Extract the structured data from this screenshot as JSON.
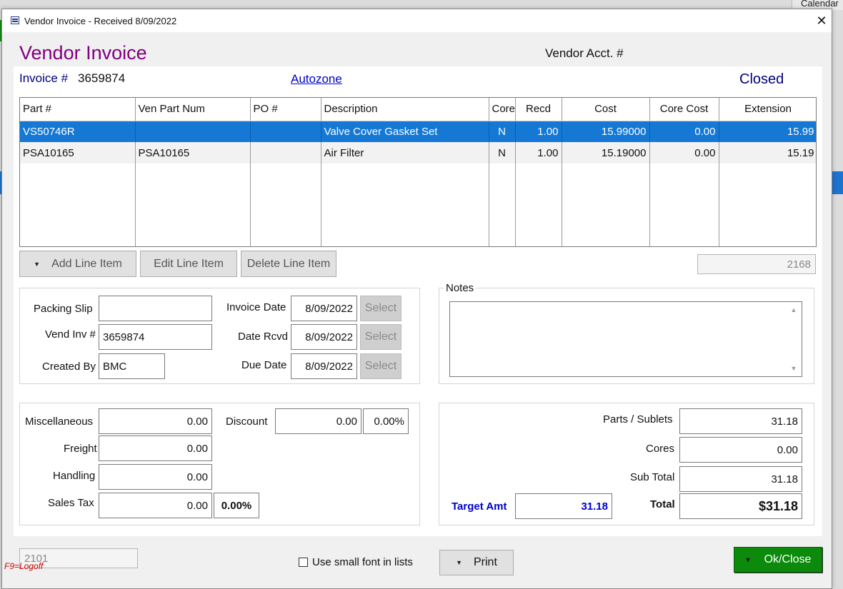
{
  "background": {
    "top_right_text": "Calendar"
  },
  "window": {
    "title": "Vendor Invoice - Received  8/09/2022",
    "close_glyph": "✕"
  },
  "header": {
    "title": "Vendor Invoice",
    "vendor_acct_label": "Vendor Acct. #",
    "invoice_label": "Invoice #",
    "invoice_number": "3659874",
    "vendor_name": "Autozone",
    "status": "Closed"
  },
  "grid": {
    "columns": [
      "Part #",
      "Ven Part Num",
      "PO #",
      "Description",
      "Core",
      "Recd",
      "Cost",
      "Core Cost",
      "Extension"
    ],
    "rows": [
      {
        "part": "VS50746R",
        "ven_part": "",
        "po": "",
        "description": "Valve Cover Gasket Set",
        "core": "N",
        "recd": "1.00",
        "cost": "15.99000",
        "core_cost": "0.00",
        "extension": "15.99",
        "selected": true
      },
      {
        "part": "PSA10165",
        "ven_part": "PSA10165",
        "po": "",
        "description": "Air Filter",
        "core": "N",
        "recd": "1.00",
        "cost": "15.19000",
        "core_cost": "0.00",
        "extension": "15.19",
        "selected": false
      }
    ]
  },
  "line_buttons": {
    "add": "Add Line Item",
    "edit": "Edit Line Item",
    "delete": "Delete Line Item"
  },
  "grid_id_box": "2168",
  "details": {
    "packing_slip_label": "Packing Slip",
    "packing_slip": "",
    "vend_inv_label": "Vend Inv #",
    "vend_inv": "3659874",
    "created_by_label": "Created By",
    "created_by": "BMC",
    "invoice_date_label": "Invoice Date",
    "invoice_date": "8/09/2022",
    "date_rcvd_label": "Date Rcvd",
    "date_rcvd": "8/09/2022",
    "due_date_label": "Due Date",
    "due_date": "8/09/2022",
    "select_label": "Select"
  },
  "notes": {
    "label": "Notes",
    "value": ""
  },
  "charges": {
    "misc_label": "Miscellaneous",
    "misc": "0.00",
    "freight_label": "Freight",
    "freight": "0.00",
    "handling_label": "Handling",
    "handling": "0.00",
    "sales_tax_label": "Sales Tax",
    "sales_tax": "0.00",
    "sales_tax_pct": "0.00%",
    "discount_label": "Discount",
    "discount": "0.00",
    "discount_pct": "0.00%"
  },
  "totals": {
    "parts_label": "Parts / Sublets",
    "parts": "31.18",
    "cores_label": "Cores",
    "cores": "0.00",
    "subtotal_label": "Sub Total",
    "subtotal": "31.18",
    "target_label": "Target Amt",
    "target": "31.18",
    "total_label": "Total",
    "total": "$31.18"
  },
  "footer": {
    "id_box": "2101",
    "small_font_label": "Use small font in lists",
    "print_label": "Print",
    "ok_label": "Ok/Close",
    "logoff_hint": "F9=Logoff"
  },
  "colors": {
    "title_purple": "#800080",
    "navy": "#000080",
    "selection_blue": "#1478d4",
    "ok_green": "#0b8a0b",
    "target_blue": "#0000cc",
    "logoff_red": "#cc0000"
  }
}
